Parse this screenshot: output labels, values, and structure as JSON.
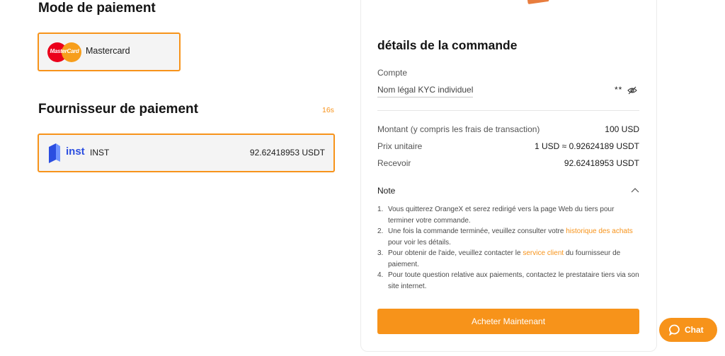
{
  "payment_method": {
    "title": "Mode de paiement",
    "selected": {
      "logo_text": "MasterCard",
      "label": "Mastercard",
      "icon": "mastercard-logo-icon"
    }
  },
  "provider": {
    "title": "Fournisseur de paiement",
    "timer": "16s",
    "selected": {
      "brand": "inst",
      "name": "INST",
      "amount": "92.62418953 USDT",
      "icon": "inst-logo-icon"
    }
  },
  "order": {
    "title": "détails de la commande",
    "account_label": "Compte",
    "kyc_label": "Nom légal KYC individuel",
    "kyc_masked": "**",
    "rows": {
      "amount": {
        "label": "Montant (y compris les frais de transaction)",
        "value": "100 USD"
      },
      "price": {
        "label": "Prix unitaire",
        "value": "1 USD ≈ 0.92624189 USDT"
      },
      "receive": {
        "label": "Recevoir",
        "value": "92.62418953 USDT"
      }
    },
    "note": {
      "title": "Note",
      "items": [
        {
          "num": "1.",
          "text": "Vous quitterez OrangeX et serez redirigé vers la page Web du tiers pour terminer votre commande."
        },
        {
          "num": "2.",
          "text_before": "Une fois la commande terminée, veuillez consulter votre ",
          "link": "historique des achats",
          "text_after": " pour voir les détails."
        },
        {
          "num": "3.",
          "text_before": "Pour obtenir de l'aide, veuillez contacter le ",
          "link": "service client",
          "text_after": " du fournisseur de paiement."
        },
        {
          "num": "4.",
          "text": "Pour toute question relative aux paiements, contactez le prestataire tiers via son site internet."
        }
      ]
    },
    "buy_button": "Acheter Maintenant"
  },
  "chat": {
    "label": "Chat"
  },
  "colors": {
    "accent": "#f7931a",
    "inst_blue": "#2b4ee0",
    "mc_red": "#eb001b",
    "mc_yellow": "#f79e1b"
  }
}
